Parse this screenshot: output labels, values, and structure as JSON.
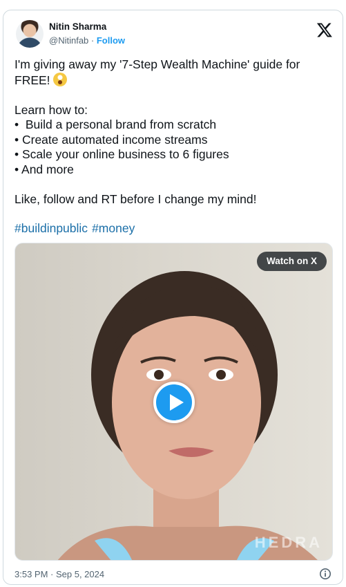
{
  "author": {
    "name": "Nitin Sharma",
    "handle": "@Nitinfab",
    "separator": " · ",
    "follow_label": "Follow"
  },
  "tweet": {
    "line1": "I'm giving away my '7-Step Wealth Machine' guide for",
    "line2": "FREE! ",
    "intro": "Learn how to:",
    "bullets": [
      "•  Build a personal brand from scratch",
      "• Create automated income streams",
      "• Scale your online business to 6 figures",
      "• And more"
    ],
    "cta": "Like, follow and RT before I change my mind!",
    "hashtags": [
      "#buildinpublic",
      "#money"
    ]
  },
  "media": {
    "watch_label": "Watch on X",
    "watermark": "HEDRA"
  },
  "timestamp": "3:53 PM · Sep 5, 2024",
  "colors": {
    "accent": "#1d9bf0",
    "hashtag": "#1b6fa8",
    "text": "#0f1419",
    "muted": "#536471"
  }
}
